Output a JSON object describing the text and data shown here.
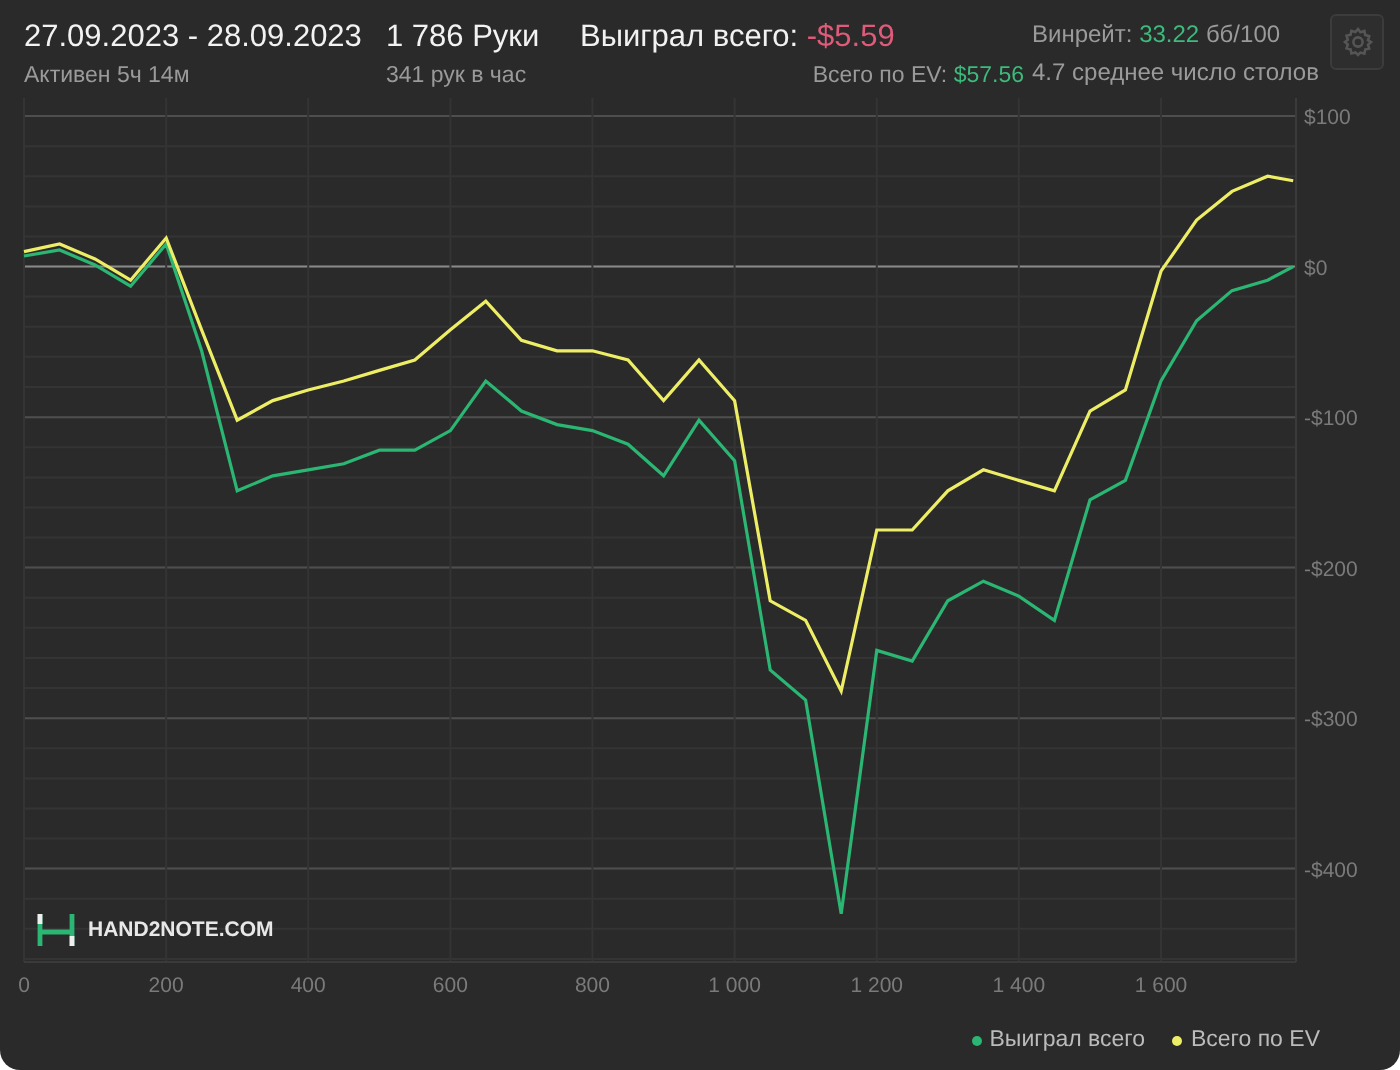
{
  "header": {
    "date_range": "27.09.2023 - 28.09.2023",
    "active": "Активен 5ч 14м",
    "hands": "1 786 Руки",
    "hands_per_hour": "341 рук в час",
    "won_label": "Выиграл всего:",
    "won_value": "-$5.59",
    "ev_label": "Всего по EV:",
    "ev_value": "$57.56",
    "winrate_label": "Винрейт:",
    "winrate_value": "33.22",
    "winrate_unit": "бб/100",
    "tables": "4.7 среднее число столов"
  },
  "chart": {
    "logo": "HAND2NOTE.COM",
    "chart_data": {
      "type": "line",
      "x": [
        0,
        50,
        100,
        150,
        200,
        250,
        300,
        350,
        400,
        450,
        500,
        550,
        600,
        650,
        700,
        750,
        800,
        850,
        900,
        950,
        1000,
        1050,
        1100,
        1150,
        1200,
        1250,
        1300,
        1350,
        1400,
        1450,
        1500,
        1550,
        1600,
        1650,
        1700,
        1750,
        1786
      ],
      "series": [
        {
          "name": "Выиграл всего",
          "color": "#2bb673",
          "values": [
            7,
            11,
            1,
            -13,
            15,
            -56,
            -149,
            -139,
            -135,
            -131,
            -122,
            -122,
            -109,
            -76,
            -96,
            -105,
            -109,
            -118,
            -139,
            -102,
            -129,
            -268,
            -288,
            -430,
            -255,
            -262,
            -222,
            -209,
            -219,
            -235,
            -155,
            -142,
            -76,
            -36,
            -16,
            -9,
            0
          ]
        },
        {
          "name": "Всего по EV",
          "color": "#eeee66",
          "values": [
            10,
            15,
            5,
            -9,
            19,
            -42,
            -102,
            -89,
            -82,
            -76,
            -69,
            -62,
            -42,
            -23,
            -49,
            -56,
            -56,
            -62,
            -89,
            -62,
            -89,
            -222,
            -235,
            -282,
            -175,
            -175,
            -149,
            -135,
            -142,
            -149,
            -96,
            -82,
            -3,
            31,
            50,
            60,
            57
          ]
        }
      ],
      "grid": true,
      "xlim": [
        0,
        1790
      ],
      "ylim": [
        -462,
        112
      ],
      "xticks": [
        {
          "value": 0,
          "label": "0"
        },
        {
          "value": 200,
          "label": "200"
        },
        {
          "value": 400,
          "label": "400"
        },
        {
          "value": 600,
          "label": "600"
        },
        {
          "value": 800,
          "label": "800"
        },
        {
          "value": 1000,
          "label": "1 000"
        },
        {
          "value": 1200,
          "label": "1 200"
        },
        {
          "value": 1400,
          "label": "1 400"
        },
        {
          "value": 1600,
          "label": "1 600"
        }
      ],
      "yticks": [
        {
          "value": 100,
          "label": "$100"
        },
        {
          "value": 0,
          "label": "$0"
        },
        {
          "value": -100,
          "label": "-$100"
        },
        {
          "value": -200,
          "label": "-$200"
        },
        {
          "value": -300,
          "label": "-$300"
        },
        {
          "value": -400,
          "label": "-$400"
        }
      ]
    }
  }
}
